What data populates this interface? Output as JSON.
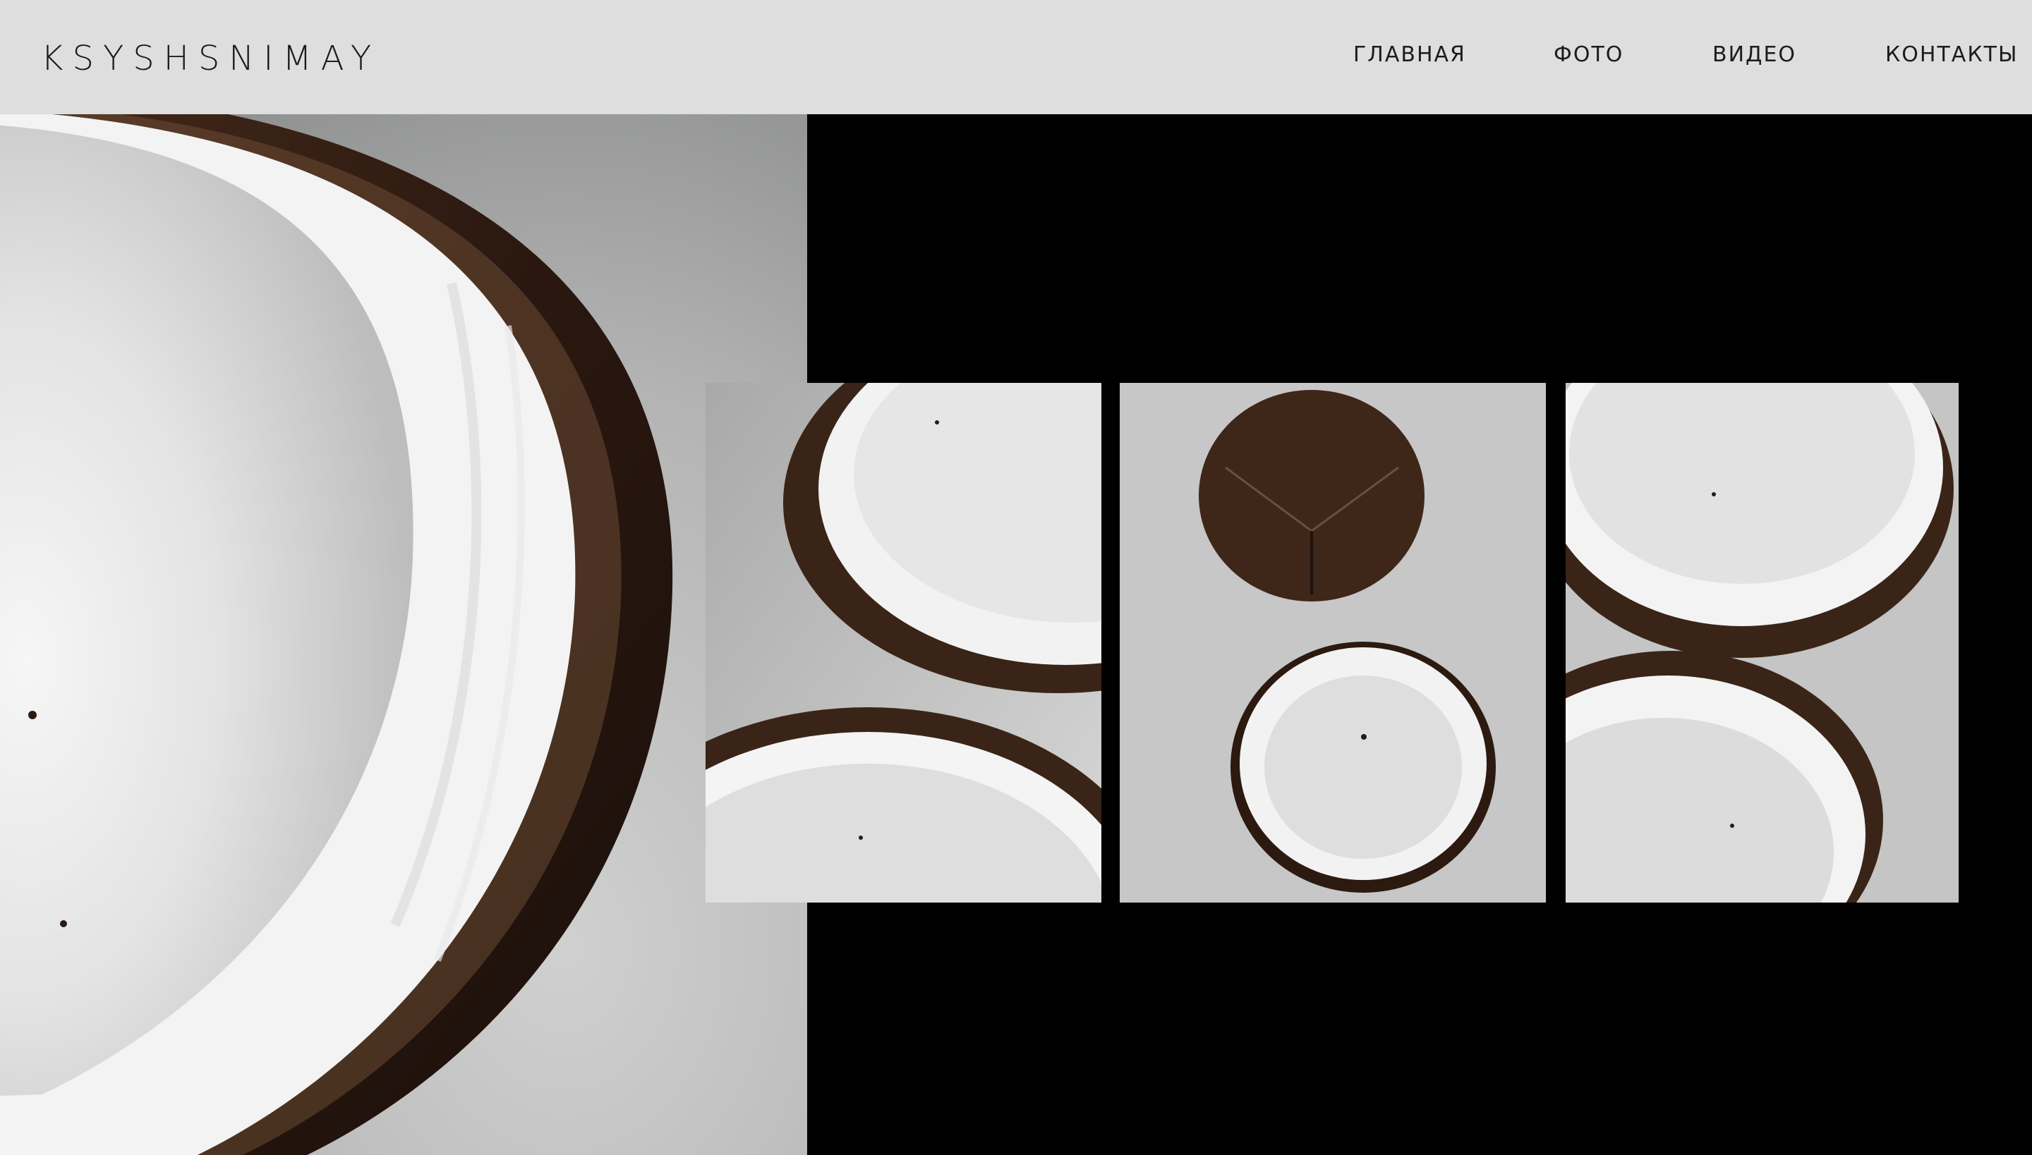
{
  "brand": {
    "logo": "KSYSHSNIMAY"
  },
  "nav": {
    "items": [
      {
        "label": "ГЛАВНАЯ"
      },
      {
        "label": "ФОТО"
      },
      {
        "label": "ВИДЕО"
      },
      {
        "label": "КОНТАКТЫ"
      }
    ]
  },
  "colors": {
    "header_bg": "#dedede",
    "page_bg": "#000000",
    "text": "#1c1c1c",
    "coconut_shell": "#3a2418",
    "coconut_flesh": "#f4f4f4"
  }
}
